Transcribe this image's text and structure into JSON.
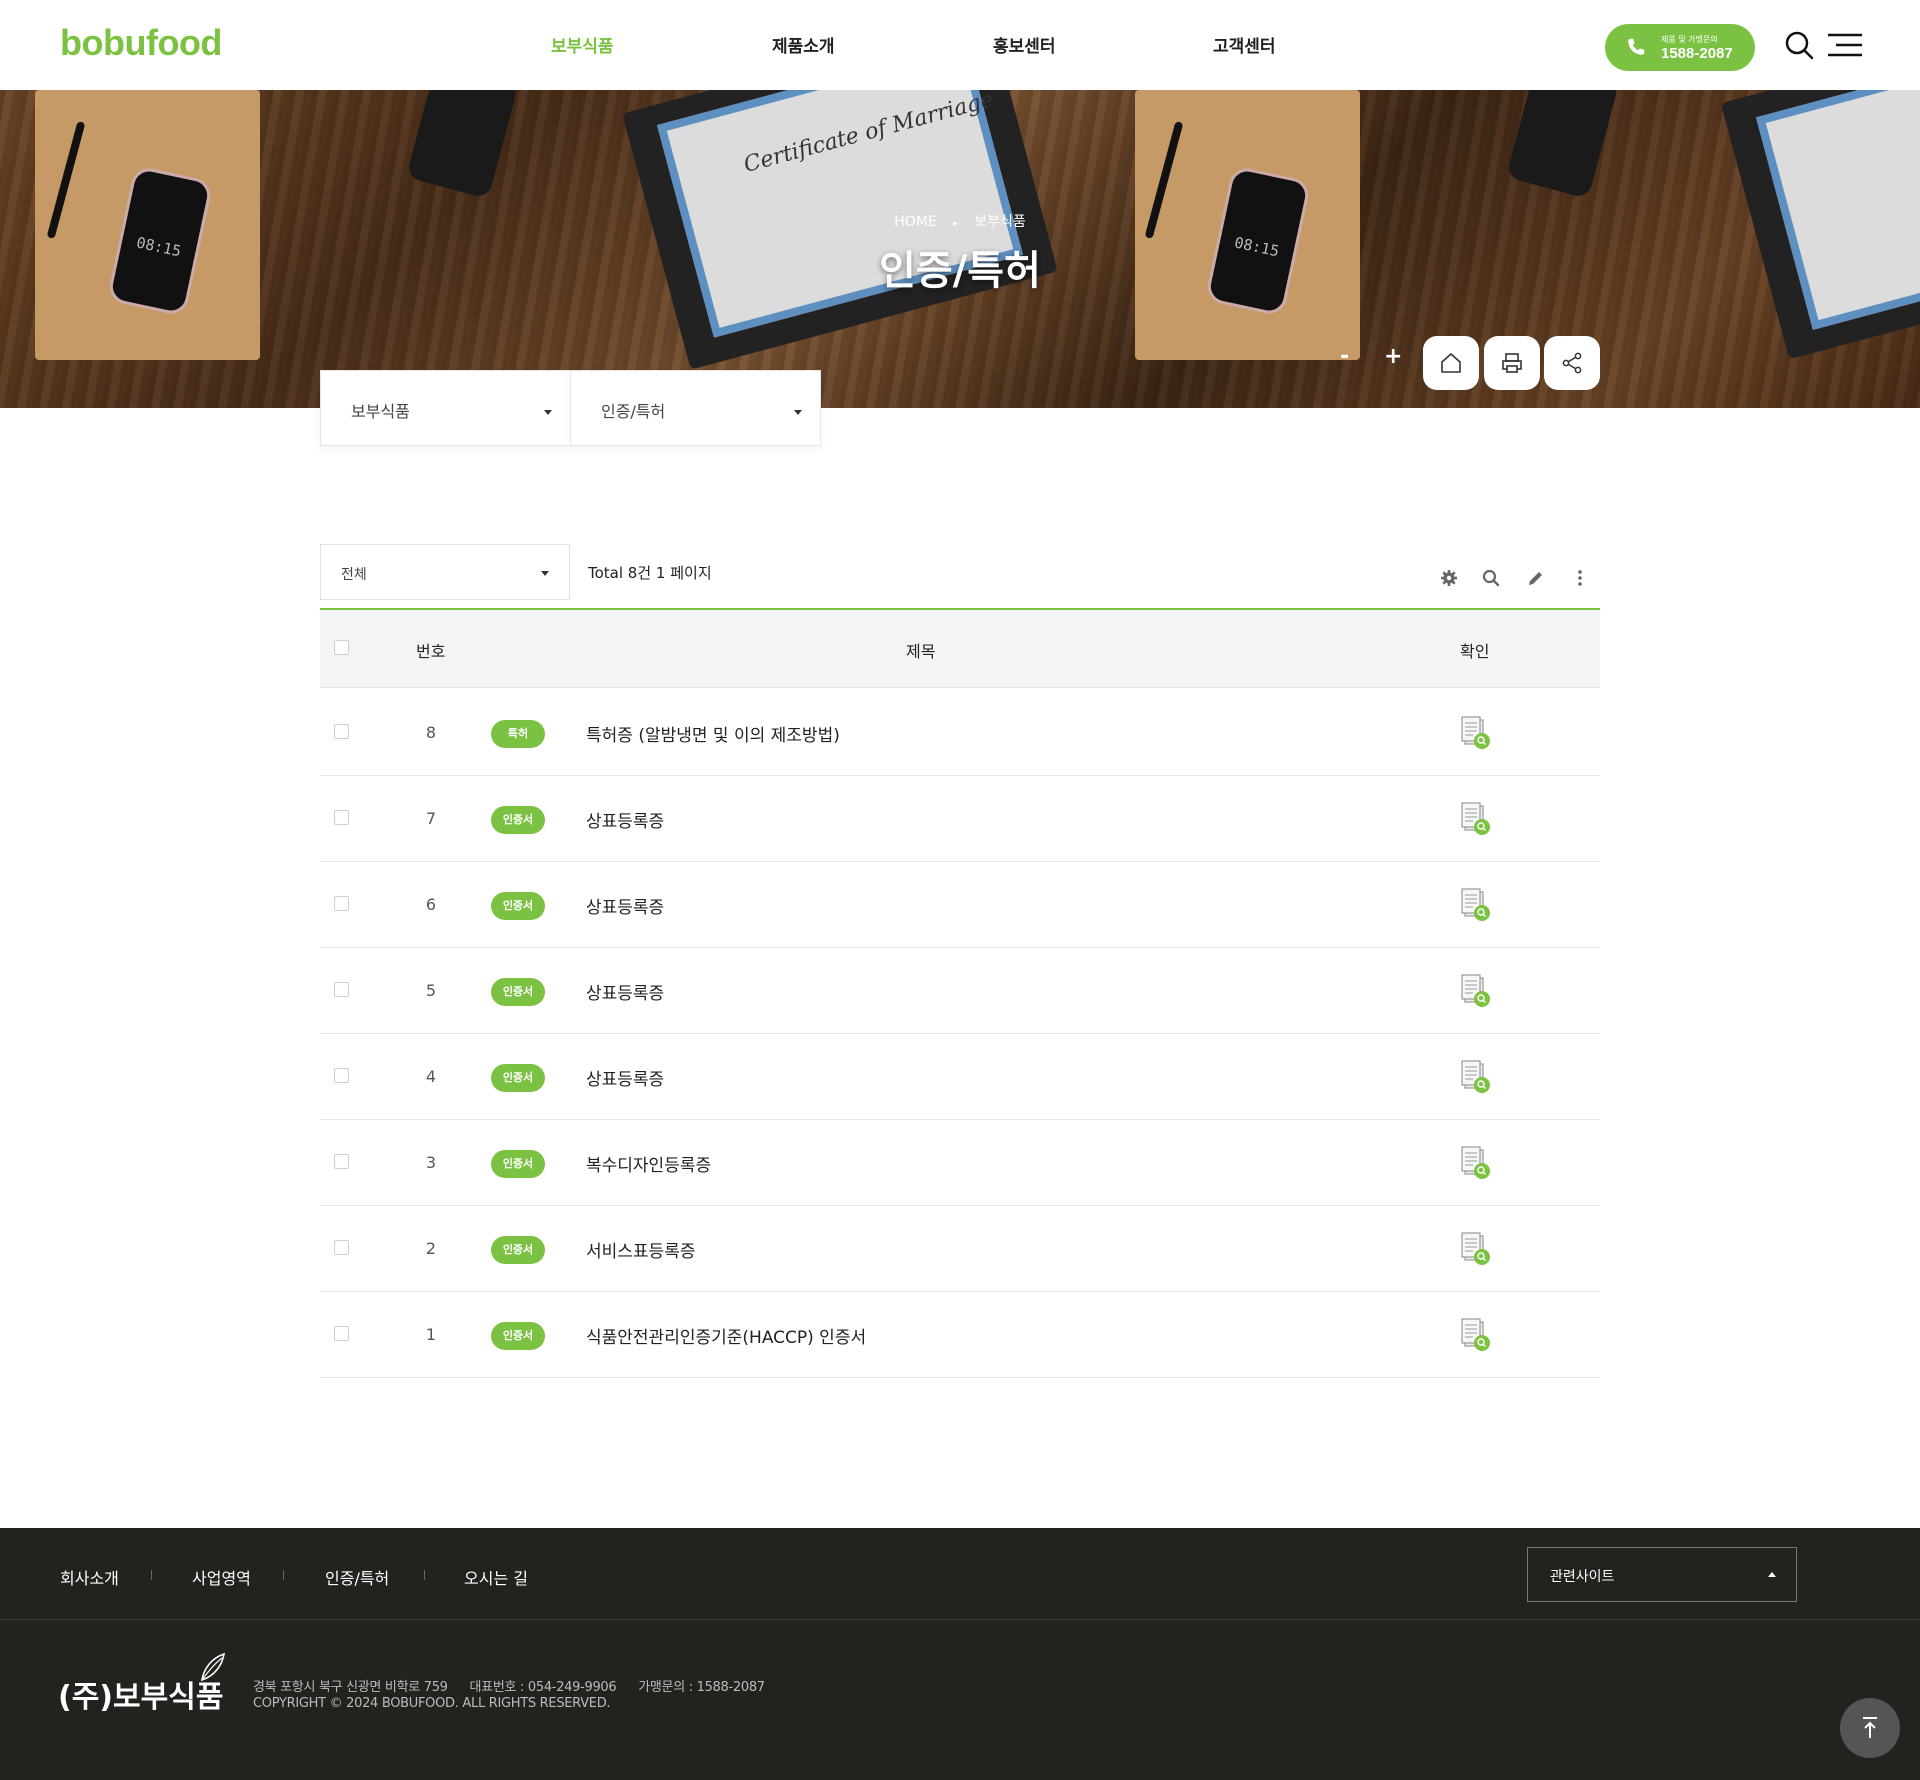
{
  "header": {
    "logo": "bobufood",
    "nav": [
      "보부식품",
      "제품소개",
      "홍보센터",
      "고객센터"
    ],
    "active_nav": "보부식품",
    "call": {
      "caption": "제품 및 가맹문의",
      "number": "1588-2087"
    }
  },
  "hero": {
    "breadcrumb": [
      "HOME",
      "보부식품"
    ],
    "title": "인증/특허",
    "zoom_out": "-",
    "zoom_in": "+"
  },
  "location": {
    "depth1": "보부식품",
    "depth2": "인증/특허"
  },
  "list": {
    "category": "전체",
    "total": "Total 8건 1 페이지",
    "headers": {
      "no": "번호",
      "title": "제목",
      "check": "확인"
    },
    "rows": [
      {
        "no": "8",
        "badge": "특허",
        "title": "특허증 (알밤냉면 및 이의 제조방법)"
      },
      {
        "no": "7",
        "badge": "인증서",
        "title": "상표등록증"
      },
      {
        "no": "6",
        "badge": "인증서",
        "title": "상표등록증"
      },
      {
        "no": "5",
        "badge": "인증서",
        "title": "상표등록증"
      },
      {
        "no": "4",
        "badge": "인증서",
        "title": "상표등록증"
      },
      {
        "no": "3",
        "badge": "인증서",
        "title": "복수디자인등록증"
      },
      {
        "no": "2",
        "badge": "인증서",
        "title": "서비스표등록증"
      },
      {
        "no": "1",
        "badge": "인증서",
        "title": "식품안전관리인증기준(HACCP) 인증서"
      }
    ]
  },
  "footer": {
    "links": [
      "회사소개",
      "사업영역",
      "인증/특허",
      "오시는 길"
    ],
    "related": "관련사이트",
    "logo": "(주)보부식품",
    "address": "경북 포항시 북구 신광면 비학로 759",
    "tel": "대표번호 : 054-249-9906",
    "franchise": "가맹문의 : 1588-2087",
    "copyright": "COPYRIGHT © 2024 BOBUFOOD. ALL RIGHTS RESERVED."
  },
  "colors": {
    "accent": "#7cc242",
    "footer_bg": "#22221f"
  },
  "icons": [
    "phone-icon",
    "search-icon",
    "menu-icon",
    "home-icon",
    "print-icon",
    "share-icon",
    "gear-icon",
    "pencil-icon",
    "more-icon",
    "document-icon",
    "arrow-up-icon"
  ]
}
